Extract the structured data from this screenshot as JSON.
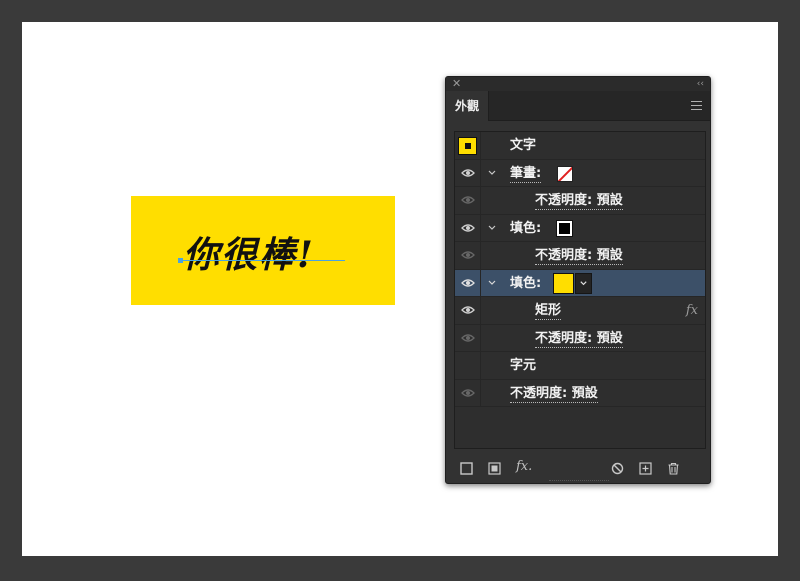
{
  "artwork": {
    "text": "你很棒!",
    "fill_color": "#ffde00"
  },
  "panel": {
    "tab_label": "外觀",
    "rows": [
      {
        "label": "文字"
      },
      {
        "label": "筆畫:"
      },
      {
        "label": "不透明度: 預設"
      },
      {
        "label": "填色:"
      },
      {
        "label": "不透明度: 預設"
      },
      {
        "label": "填色:"
      },
      {
        "label": "矩形",
        "effect": "fx"
      },
      {
        "label": "不透明度: 預設"
      },
      {
        "label": "字元"
      },
      {
        "label": "不透明度: 預設"
      }
    ],
    "footer": {
      "fx_label": "fx."
    }
  },
  "colors": {
    "panel_bg": "#323232",
    "selected_row": "#3c5068",
    "fill_yellow": "#ffde00",
    "stroke_red": "#e02020"
  },
  "icons": [
    "close-icon",
    "collapse-icon",
    "menu-icon",
    "eye-icon",
    "chevron-down-icon",
    "new-stroke-icon",
    "new-fill-icon",
    "fx-icon",
    "clear-appearance-icon",
    "duplicate-icon",
    "trash-icon"
  ]
}
